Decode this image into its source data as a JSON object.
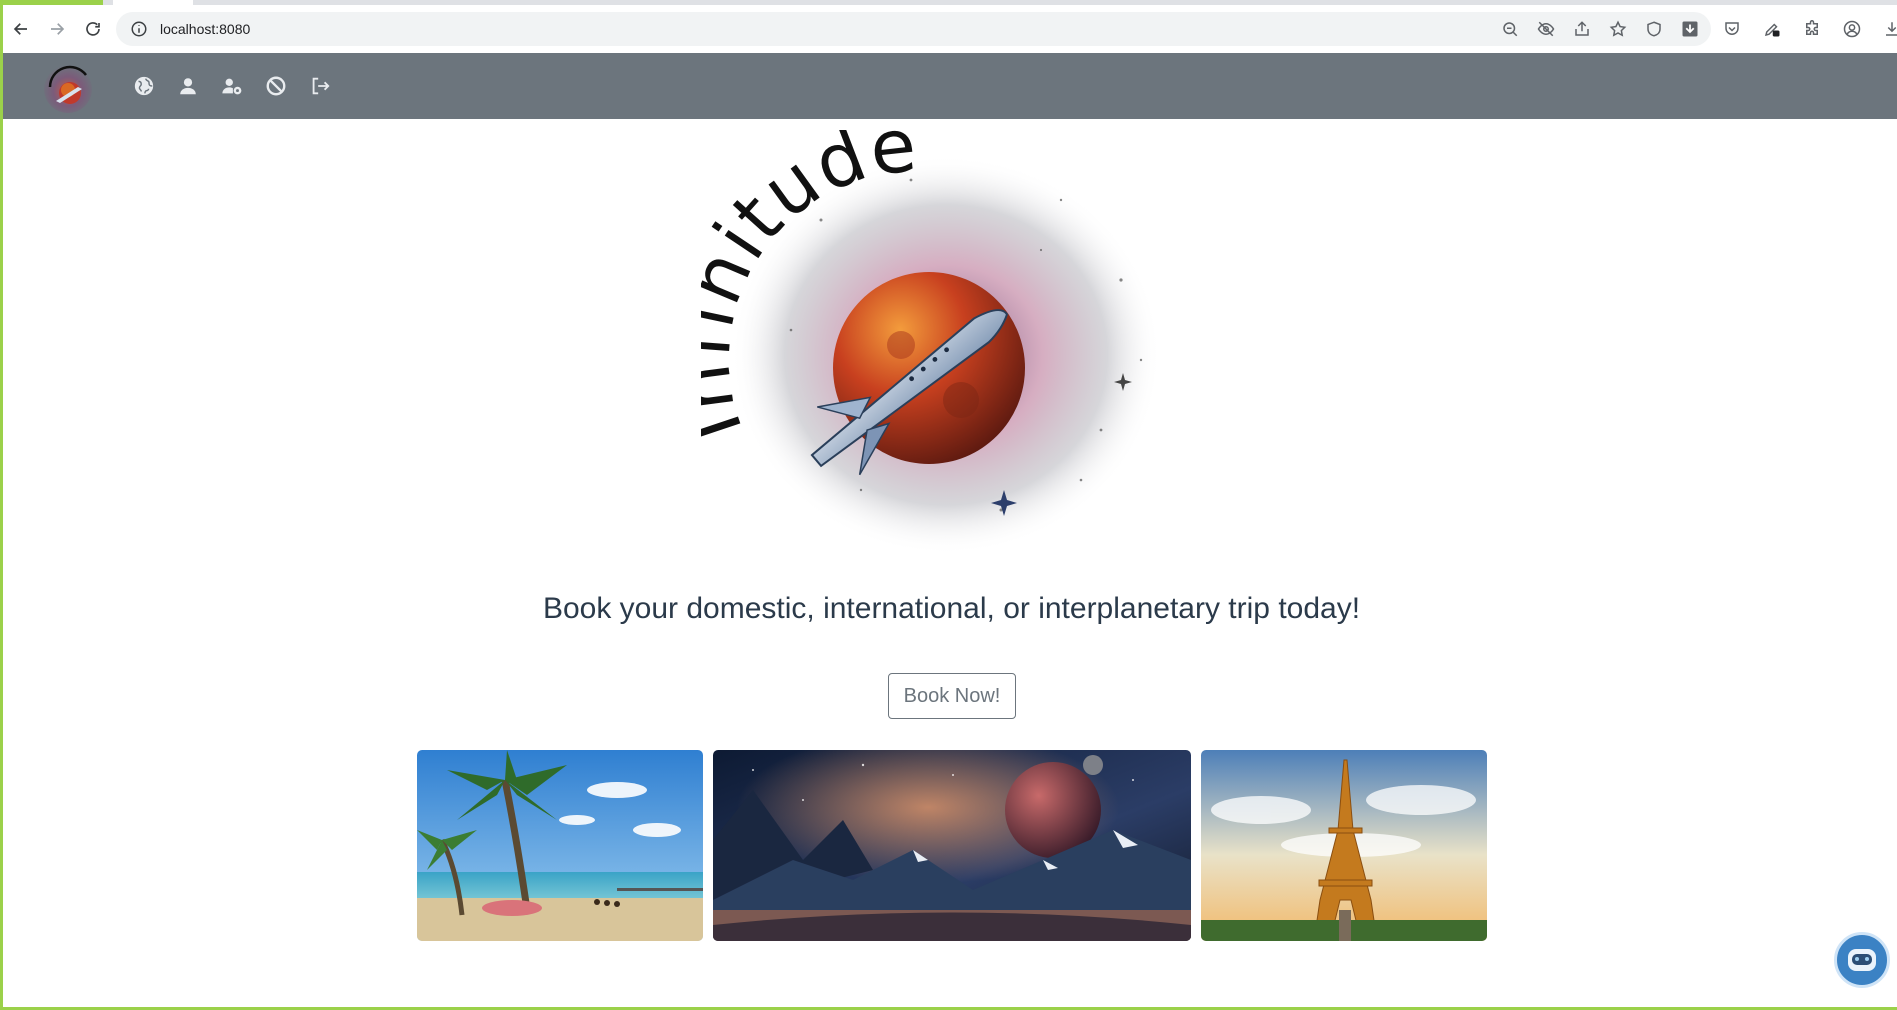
{
  "browser": {
    "url": "localhost:8080",
    "info_icon": "info-icon",
    "nav": [
      "back-icon",
      "forward-icon",
      "reload-icon"
    ],
    "omnibox_actions": [
      "zoom-out-icon",
      "eye-off-icon",
      "share-icon",
      "star-icon",
      "shield-icon",
      "download-arrow-icon"
    ],
    "extensions": [
      "pocket-icon",
      "pen-extension-icon",
      "puzzle-icon",
      "profile-icon",
      "download-icon"
    ]
  },
  "navbar": {
    "brand_logo": "infinitude-logo",
    "icons": [
      "globe-icon",
      "user-icon",
      "user-cog-icon",
      "ban-icon",
      "logout-icon"
    ]
  },
  "hero": {
    "logo_text": "Infinitude",
    "tagline": "Book your domestic, international, or interplanetary trip today!",
    "cta_label": "Book Now!"
  },
  "gallery": {
    "images": [
      "beach-palm-image",
      "space-planet-landscape-image",
      "eiffel-tower-image"
    ]
  },
  "colors": {
    "navbar_bg": "#6c757d",
    "tagline": "#2b3a4a",
    "button_border": "#6c757d",
    "chat_bubble": "#3b82c4",
    "page_accent": "#9bd14a"
  }
}
